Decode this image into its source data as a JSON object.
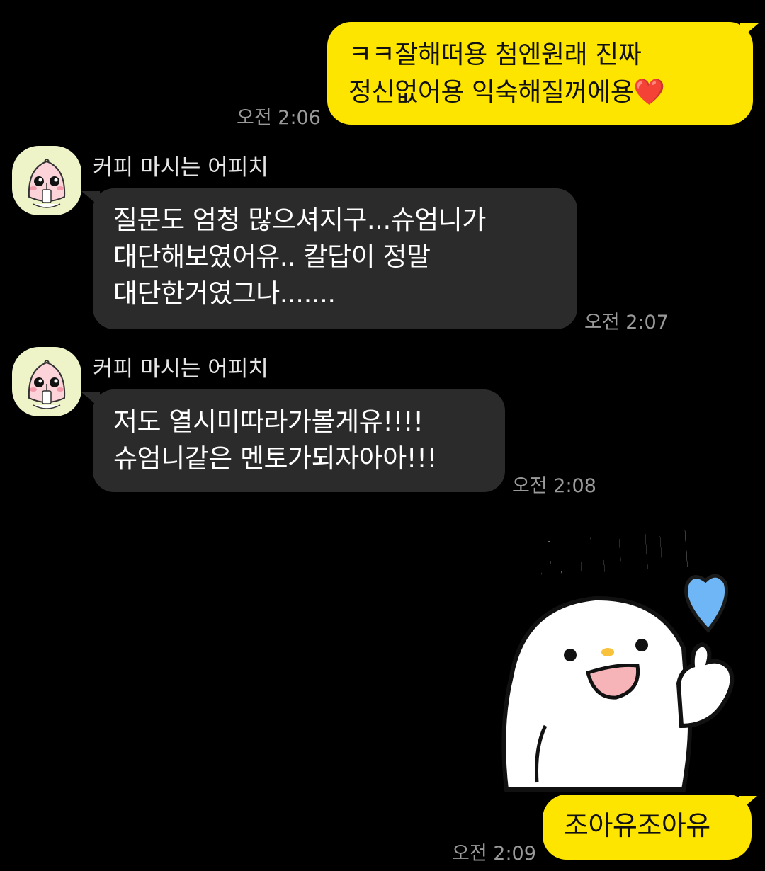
{
  "messages": {
    "m1": {
      "text": "ㅋㅋ잘해떠용 첨엔원래 진짜\n정신없어용 익숙해질꺼에용❤️",
      "time": "오전 2:06"
    },
    "m2": {
      "sender": "커피 마시는 어피치",
      "text": "질문도 엄청 많으셔지구...슈엄니가\n대단해보였어유.. 칼답이 정말\n대단한거였그나.......",
      "time": "오전 2:07"
    },
    "m3": {
      "sender": "커피 마시는 어피치",
      "text": "저도 열시미따라가볼게유!!!!\n슈엄니같은 멘토가되자아아!!!",
      "time": "오전 2:08"
    },
    "m4": {
      "sticker_text": "좋습니다",
      "sticker_icon": "thumbs-up-ghost-with-blue-heart",
      "text": "조아유조아유",
      "time": "오전 2:09"
    }
  },
  "colors": {
    "background": "#000000",
    "my_bubble": "#FEE500",
    "their_bubble": "#2B2B2B",
    "timestamp": "#9A9A9A"
  },
  "icons": {
    "avatar": "apeach-avatar-icon"
  }
}
